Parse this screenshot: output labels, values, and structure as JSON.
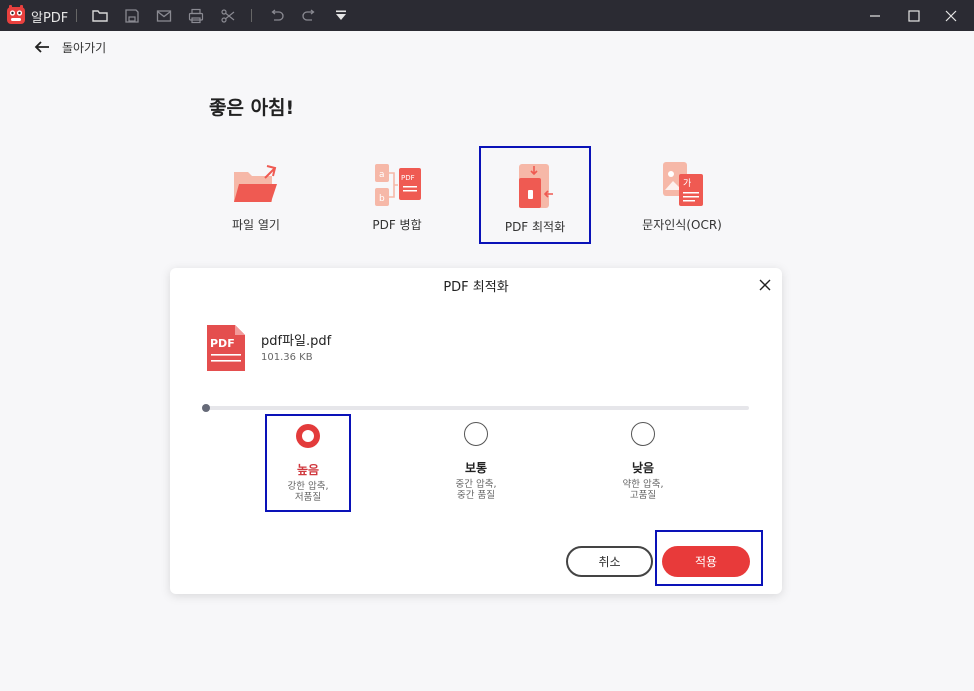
{
  "app": {
    "name": "알PDF"
  },
  "nav": {
    "back_label": "돌아가기"
  },
  "greeting": "좋은 아침!",
  "tools": [
    {
      "label": "파일 열기",
      "icon": "folder-open-icon"
    },
    {
      "label": "PDF 병합",
      "icon": "pdf-merge-icon"
    },
    {
      "label": "PDF 최적화",
      "icon": "pdf-compress-icon",
      "selected": true
    },
    {
      "label": "문자인식(OCR)",
      "icon": "ocr-icon"
    }
  ],
  "dialog": {
    "title": "PDF 최적화",
    "file": {
      "name": "pdf파일.pdf",
      "size": "101.36 KB",
      "icon_text": "PDF"
    },
    "options": [
      {
        "title": "높음",
        "desc1": "강한 압축,",
        "desc2": "저품질",
        "selected": true
      },
      {
        "title": "보통",
        "desc1": "중간 압축,",
        "desc2": "중간 품질",
        "selected": false
      },
      {
        "title": "낮음",
        "desc1": "약한 압축,",
        "desc2": "고품질",
        "selected": false
      }
    ],
    "cancel_label": "취소",
    "apply_label": "적용"
  },
  "colors": {
    "accent": "#e83a3a",
    "titlebar": "#2b2b33",
    "highlight_box": "#0a12b8",
    "background": "#f7f7f9"
  }
}
